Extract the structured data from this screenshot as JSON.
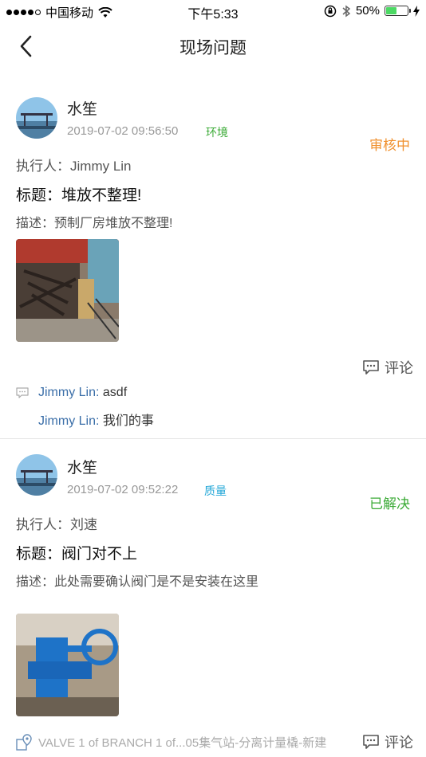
{
  "status_bar": {
    "carrier": "中国移动",
    "time": "下午5:33",
    "battery": "50%"
  },
  "nav": {
    "title": "现场问题"
  },
  "colors": {
    "pending": "#f0902d",
    "resolved": "#3aaa35",
    "category_env": "#3aaa35",
    "category_quality": "#25a8d8",
    "comment_author": "#3a6ea8"
  },
  "issues": [
    {
      "user_name": "水笙",
      "timestamp": "2019-07-02 09:56:50",
      "category": "环境",
      "status": "审核中",
      "executor": "执行人：Jimmy Lin",
      "title": "标题：堆放不整理!",
      "description": "描述：预制厂房堆放不整理!",
      "comment_label": "评论",
      "comments": [
        {
          "author": "Jimmy Lin:",
          "text": "asdf"
        },
        {
          "author": "Jimmy Lin:",
          "text": "我们的事"
        }
      ]
    },
    {
      "user_name": "水笙",
      "timestamp": "2019-07-02 09:52:22",
      "category": "质量",
      "status": "已解决",
      "executor": "执行人：刘速",
      "title": "标题：阀门对不上",
      "description": "描述：此处需要确认阀门是不是安装在这里",
      "location": "VALVE 1 of BRANCH 1 of...05集气站-分离计量橇-新建",
      "comment_label": "评论"
    }
  ]
}
